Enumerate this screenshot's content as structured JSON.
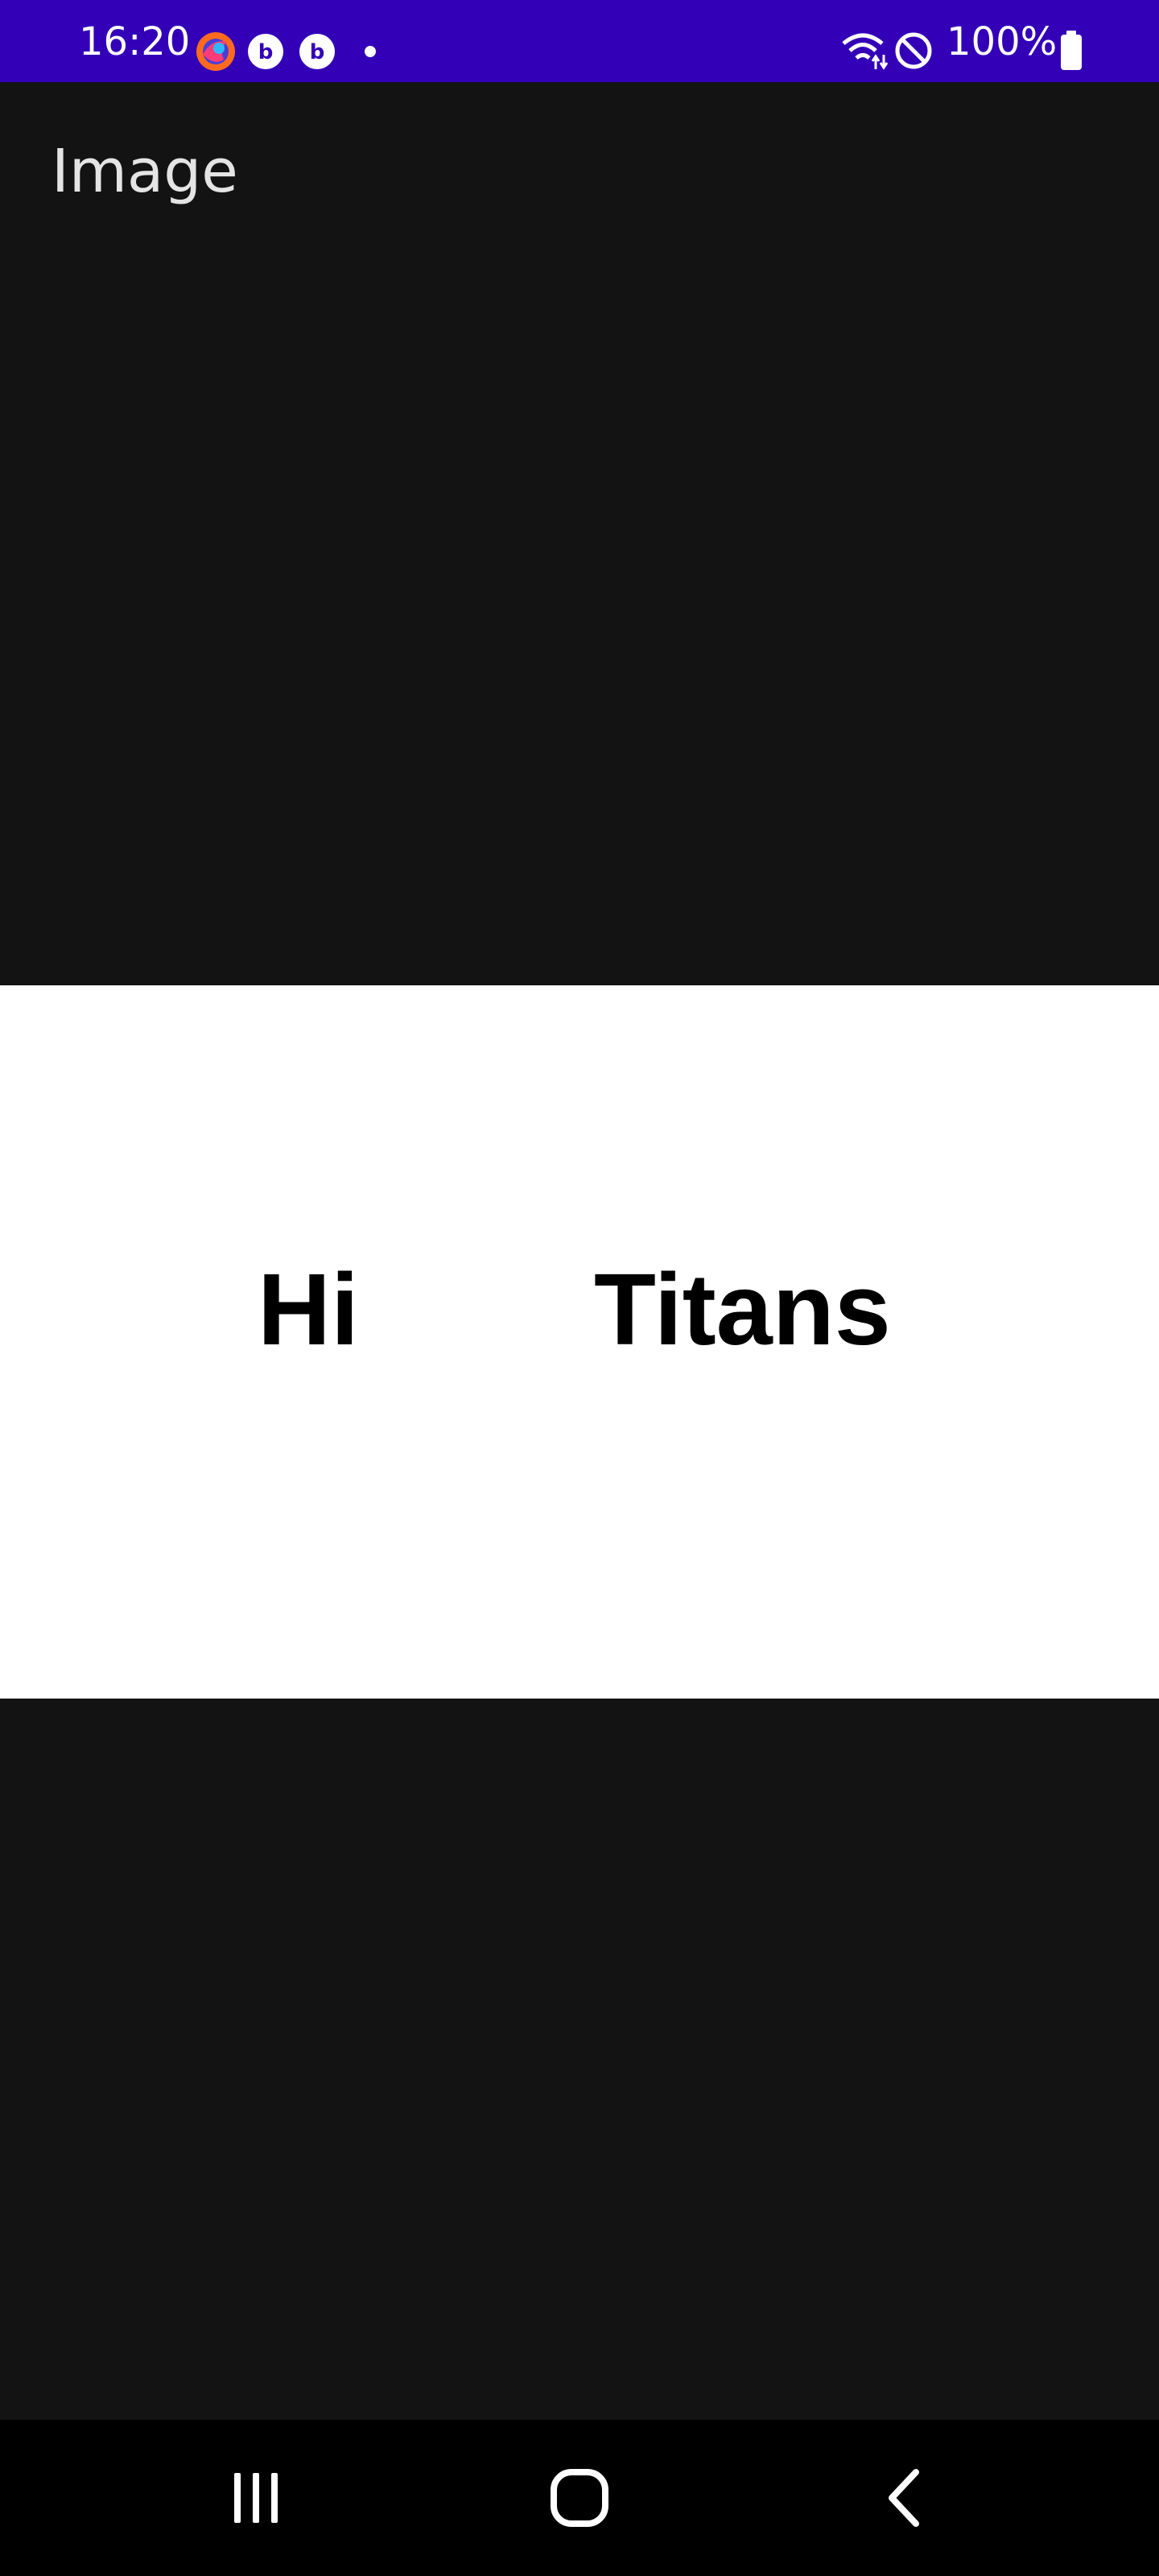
{
  "status_bar": {
    "time": "16:20",
    "battery": "100%",
    "icons": [
      "firefox-icon",
      "b-app-icon",
      "b-app-icon",
      "notification-dot-icon",
      "wifi-icon",
      "do-not-disturb-icon",
      "battery-icon"
    ]
  },
  "toolbar": {
    "title": "Image"
  },
  "image": {
    "words": [
      "Hi",
      "Titans"
    ]
  },
  "nav_bar": {
    "buttons": [
      "recent-apps-icon",
      "home-icon",
      "back-icon"
    ]
  },
  "colors": {
    "status_bar": "#3300b8",
    "background": "#131313",
    "image_background": "#ffffff",
    "nav_bar": "#000000"
  }
}
